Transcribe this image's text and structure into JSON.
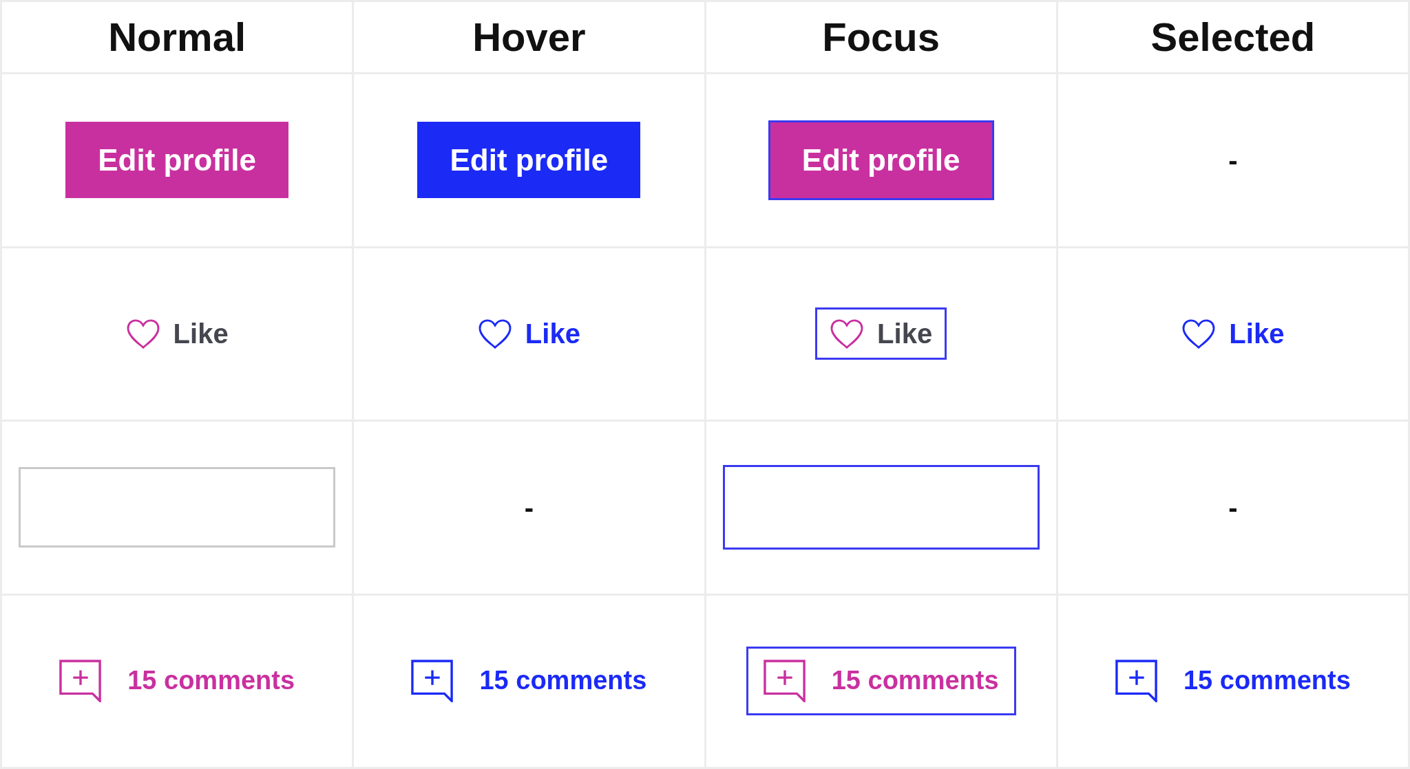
{
  "columns": [
    "Normal",
    "Hover",
    "Focus",
    "Selected"
  ],
  "rows": [
    {
      "cells": [
        {
          "kind": "button",
          "highlighted": false,
          "focused": false,
          "label": "Edit profile"
        },
        {
          "kind": "button",
          "highlighted": true,
          "focused": false,
          "label": "Edit profile"
        },
        {
          "kind": "button",
          "highlighted": false,
          "focused": true,
          "label": "Edit profile"
        },
        {
          "kind": "dash",
          "text": "-"
        }
      ]
    },
    {
      "cells": [
        {
          "kind": "like",
          "highlighted": false,
          "focused": false,
          "label": "Like"
        },
        {
          "kind": "like",
          "highlighted": true,
          "focused": false,
          "label": "Like"
        },
        {
          "kind": "like",
          "highlighted": false,
          "focused": true,
          "label": "Like"
        },
        {
          "kind": "like",
          "highlighted": true,
          "focused": false,
          "label": "Like"
        }
      ]
    },
    {
      "cells": [
        {
          "kind": "input",
          "focused": false
        },
        {
          "kind": "dash",
          "text": "-"
        },
        {
          "kind": "input",
          "focused": true
        },
        {
          "kind": "dash",
          "text": "-"
        }
      ]
    },
    {
      "cells": [
        {
          "kind": "comments",
          "highlighted": false,
          "focused": false,
          "label": "15 comments"
        },
        {
          "kind": "comments",
          "highlighted": true,
          "focused": false,
          "label": "15 comments"
        },
        {
          "kind": "comments",
          "highlighted": false,
          "focused": true,
          "label": "15 comments"
        },
        {
          "kind": "comments",
          "highlighted": true,
          "focused": false,
          "label": "15 comments"
        }
      ]
    }
  ]
}
